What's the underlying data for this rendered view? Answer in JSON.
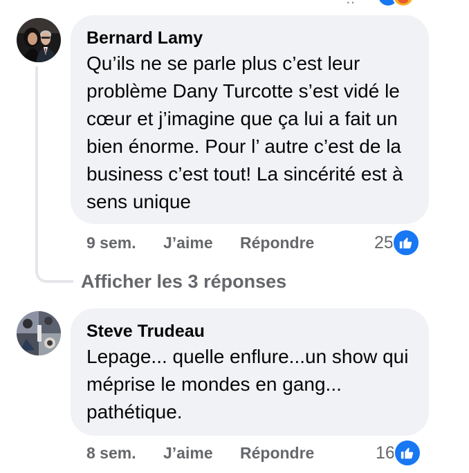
{
  "top_reactions": {
    "icons": [
      "like-icon",
      "haha-icon"
    ]
  },
  "comments": [
    {
      "author": "Bernard Lamy",
      "text": "Qu’ils ne se parle plus c’est leur problème Dany Turcotte s’est vidé le cœur et j’imagine que ça lui a fait un bien énorme. Pour l’ autre c’est de la business c’est tout! La sincérité est à sens unique",
      "time": "9 sem.",
      "like_label": "J’aime",
      "reply_label": "Répondre",
      "reaction_count": "25",
      "reaction_icon": "like-icon"
    },
    {
      "author": "Steve Trudeau",
      "text": "Lepage... quelle enflure...un show qui méprise le mondes en gang... pathétique.",
      "time": "8 sem.",
      "like_label": "J’aime",
      "reply_label": "Répondre",
      "reaction_count": "16",
      "reaction_icon": "like-icon"
    }
  ],
  "replies": {
    "label": "Afficher les 3 réponses"
  },
  "colors": {
    "bubble_bg": "#f0f2f5",
    "secondary_text": "#65676b",
    "like_blue": "#1877f2",
    "thread_line": "#e4e6eb"
  }
}
